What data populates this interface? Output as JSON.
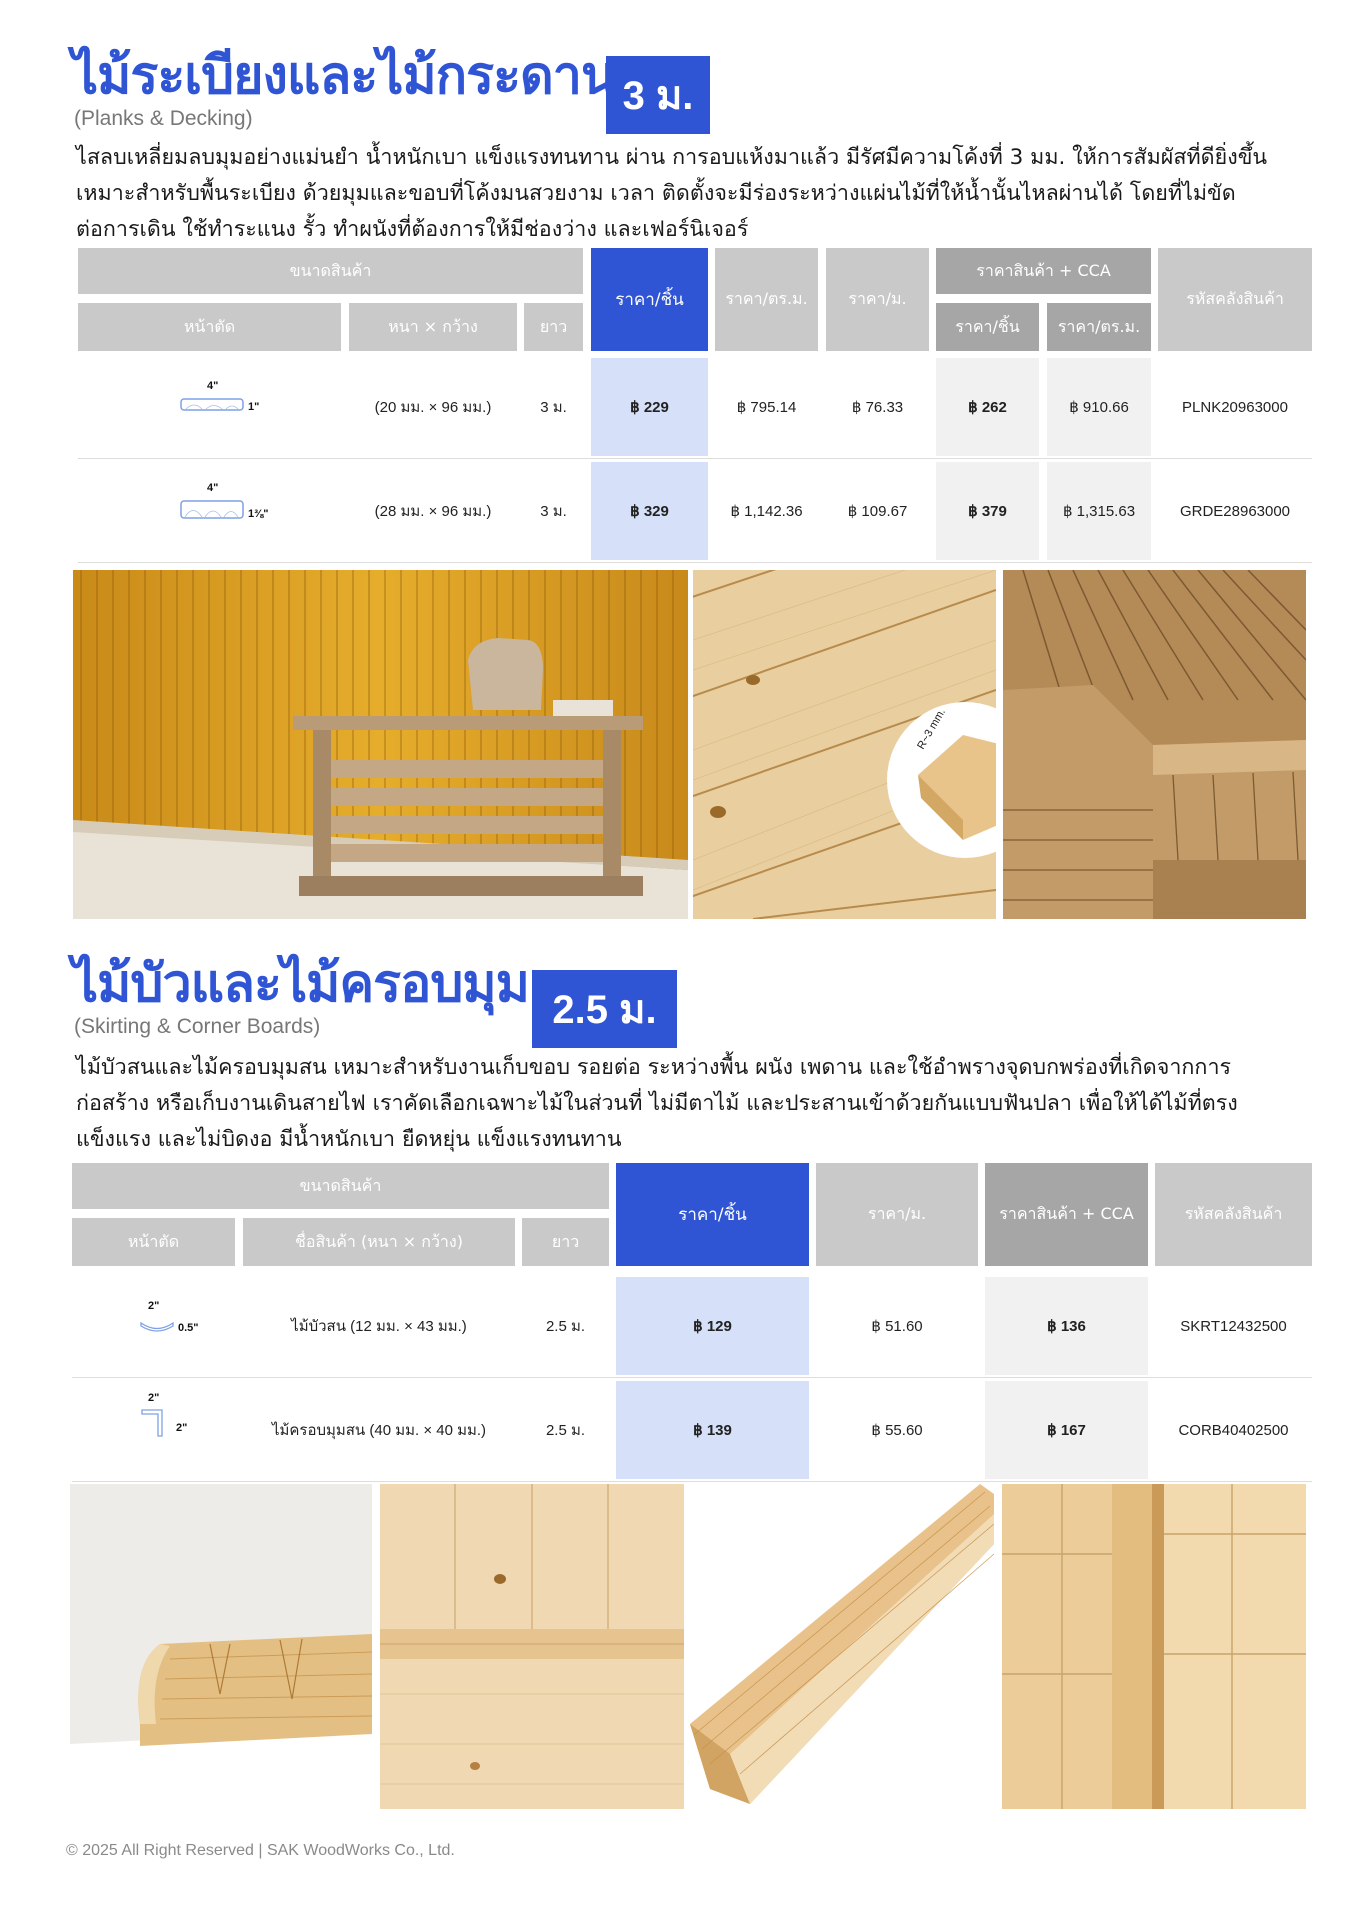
{
  "planks": {
    "title_th": "ไม้ระเบียงและไม้กระดาน",
    "title_en": "(Planks & Decking)",
    "length_badge": "3 ม.",
    "description": [
      "ไสลบเหลี่ยมลบมุมอย่างแม่นยำ น้ำหนักเบา แข็งแรงทนทาน ผ่าน การอบแห้งมาแล้ว มีรัศมีความโค้งที่ 3 มม. ให้การสัมผัสที่ดียิ่งขึ้น",
      "เหมาะสำหรับพื้นระเบียง ด้วยมุมและขอบที่โค้งมนสวยงาม เวลา ติดตั้งจะมีร่องระหว่างแผ่นไม้ที่ให้น้ำนั้นไหลผ่านได้ โดยที่ไม่ขัด",
      "ต่อการเดิน ใช้ทำระแนง รั้ว ทำผนังที่ต้องการให้มีช่องว่าง และเฟอร์นิเจอร์"
    ],
    "headers": {
      "size": "ขนาดสินค้า",
      "section": "หน้าตัด",
      "thick_width": "หนา × กว้าง",
      "length": "ยาว",
      "price_piece": "ราคา/ชิ้น",
      "price_sqm": "ราคา/ตร.ม.",
      "price_m": "ราคา/ม.",
      "cca_group": "ราคาสินค้า + CCA",
      "cca_piece": "ราคา/ชิ้น",
      "cca_sqm": "ราคา/ตร.ม.",
      "sku": "รหัสคลังสินค้า"
    },
    "rows": [
      {
        "width_label": "4\"",
        "thick_label": "1\"",
        "dims": "(20 มม. × 96 มม.)",
        "length": "3 ม.",
        "price_piece": "฿ 229",
        "price_sqm": "฿ 795.14",
        "price_m": "฿ 76.33",
        "cca_piece": "฿ 262",
        "cca_sqm": "฿ 910.66",
        "sku": "PLNK20963000"
      },
      {
        "width_label": "4\"",
        "thick_label": "1⅜\"",
        "dims": "(28 มม. × 96 มม.)",
        "length": "3 ม.",
        "price_piece": "฿ 329",
        "price_sqm": "฿ 1,142.36",
        "price_m": "฿ 109.67",
        "cca_piece": "฿ 379",
        "cca_sqm": "฿ 1,315.63",
        "sku": "GRDE28963000"
      }
    ],
    "radius_label": "R~3 mm."
  },
  "skirting": {
    "title_th": "ไม้บัวและไม้ครอบมุม",
    "title_en": "(Skirting & Corner Boards)",
    "length_badge": "2.5 ม.",
    "description": [
      "ไม้บัวสนและไม้ครอบมุมสน เหมาะสำหรับงานเก็บขอบ รอยต่อ ระหว่างพื้น ผนัง เพดาน และใช้อำพรางจุดบกพร่องที่เกิดจากการ",
      "ก่อสร้าง หรือเก็บงานเดินสายไฟ เราคัดเลือกเฉพาะไม้ในส่วนที่ ไม่มีตาไม้ และประสานเข้าด้วยกันแบบฟันปลา เพื่อให้ได้ไม้ที่ตรง",
      "แข็งแรง และไม่บิดงอ มีน้ำหนักเบา ยืดหยุ่น แข็งแรงทนทาน"
    ],
    "headers": {
      "size": "ขนาดสินค้า",
      "section": "หน้าตัด",
      "name_dims": "ชื่อสินค้า (หนา × กว้าง)",
      "length": "ยาว",
      "price_piece": "ราคา/ชิ้น",
      "price_m": "ราคา/ม.",
      "cca": "ราคาสินค้า + CCA",
      "sku": "รหัสคลังสินค้า"
    },
    "rows": [
      {
        "width_label": "2\"",
        "thick_label": "0.5\"",
        "name": "ไม้บัวสน (12 มม. × 43 มม.)",
        "length": "2.5 ม.",
        "price_piece": "฿ 129",
        "price_m": "฿ 51.60",
        "cca": "฿ 136",
        "sku": "SKRT12432500"
      },
      {
        "width_label": "2\"",
        "thick_label": "2\"",
        "name": "ไม้ครอบมุมสน (40 มม. × 40 มม.)",
        "length": "2.5 ม.",
        "price_piece": "฿ 139",
        "price_m": "฿ 55.60",
        "cca": "฿ 167",
        "sku": "CORB40402500"
      }
    ]
  },
  "footer": "© 2025 All Right Reserved | SAK WoodWorks Co., Ltd.",
  "colors": {
    "accent": "#2f55d4",
    "header_grey": "#c9c9c9",
    "header_dark": "#a6a6a6",
    "highlight": "#d6e0f8",
    "cca_bg": "#f1f1f1"
  }
}
